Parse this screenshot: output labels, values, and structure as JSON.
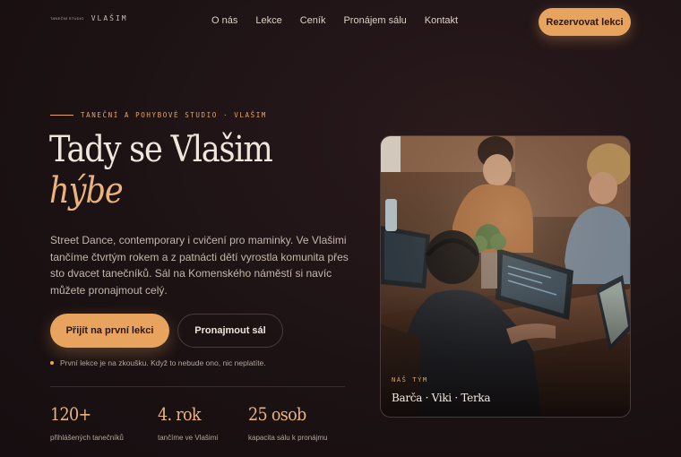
{
  "header": {
    "logo_mark": "TANEČNÍ STUDIO",
    "logo_text": "VLAŠIM",
    "menu": [
      "O nás",
      "Lekce",
      "Ceník",
      "Pronájem sálu",
      "Kontakt"
    ],
    "cta": "Rezervovat lekci"
  },
  "hero": {
    "eyebrow": "TANEČNÍ A POHYBOVÉ STUDIO · VLAŠIM",
    "title_line1": "Tady se Vlašim",
    "title_line2": "hýbe",
    "lead": "Street Dance, contemporary i cvičení pro maminky. Ve Vlašimi tančíme čtvrtým rokem a z patnácti dětí vyrostla komunita přes sto dvacet tanečníků. Sál na Komenského náměstí si navíc můžete pronajmout celý.",
    "primary_button": "Přijít na první lekci",
    "secondary_button": "Pronajmout sál",
    "note": "První lekce je na zkoušku. Když to nebude ono, nic neplatíte.",
    "stats": [
      {
        "value": "120+",
        "label": "přihlášených tanečníků"
      },
      {
        "value": "4. rok",
        "label": "tančíme ve Vlašimi"
      },
      {
        "value": "25 osob",
        "label": "kapacita sálu k pronájmu"
      }
    ]
  },
  "photo": {
    "caption_kicker": "NÁŠ TÝM",
    "caption_names": "Barča · Viki · Terka"
  },
  "colors": {
    "accent": "#e8a45e",
    "background": "#1c1214",
    "text": "#f0e6dc"
  }
}
